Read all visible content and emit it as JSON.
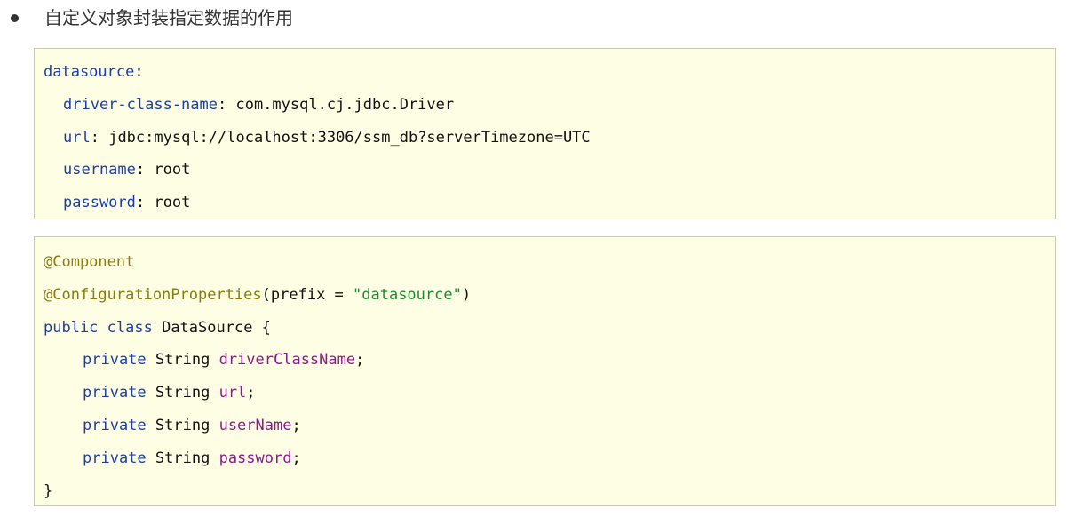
{
  "heading": {
    "text": "自定义对象封装指定数据的作用"
  },
  "yaml": {
    "root_key": "datasource",
    "entries": [
      {
        "key": "driver-class-name",
        "value": "com.mysql.cj.jdbc.Driver"
      },
      {
        "key": "url",
        "value": "jdbc:mysql://localhost:3306/ssm_db?serverTimezone=UTC"
      },
      {
        "key": "username",
        "value": "root"
      },
      {
        "key": "password",
        "value": "root"
      }
    ]
  },
  "java": {
    "annotation1": "@Component",
    "annotation2_name": "@ConfigurationProperties",
    "annotation2_param": "prefix = ",
    "annotation2_value": "\"datasource\"",
    "class_keywords": "public class",
    "class_name": "DataSource {",
    "field_modifier": "private",
    "field_type": "String",
    "fields": [
      "driverClassName",
      "url",
      "userName",
      "password"
    ],
    "closing_brace": "}"
  }
}
